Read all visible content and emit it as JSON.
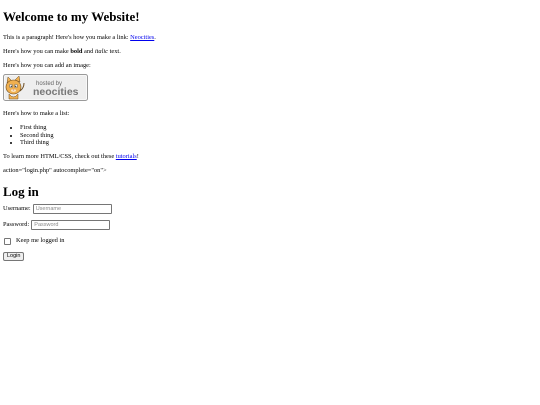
{
  "heading": "Welcome to my Website!",
  "para1": {
    "text": "This is a paragraph! Here's how you make a link: ",
    "link": "Neocities",
    "end": "."
  },
  "para2": {
    "before": "Here's how you can make ",
    "bold": "bold",
    "middle": " and ",
    "italic": "italic",
    "after": " text."
  },
  "para3": "Here's how you can add an image:",
  "image": {
    "line1": "hosted by",
    "line2": "neocities"
  },
  "para4": "Here's how to make a list:",
  "list": [
    "First thing",
    "Second thing",
    "Third thing"
  ],
  "para5": {
    "before": "To learn more HTML/CSS, check out these ",
    "link": "tutorials",
    "after": "!"
  },
  "stray_text": "action=\"login.php\" autocomplete=\"on\">",
  "login": {
    "heading": "Log in",
    "username_label": "Username:",
    "username_placeholder": "Username",
    "password_label": "Password:",
    "password_placeholder": "Password",
    "remember_label": "Keep me logged in",
    "button_label": "Login"
  },
  "colors": {
    "link": "#0000ee",
    "badge_bg": "#eeeeee",
    "cat_orange": "#f0b050"
  }
}
